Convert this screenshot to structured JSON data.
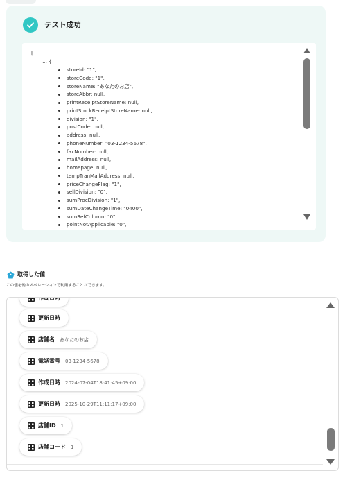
{
  "test": {
    "title": "テスト成功",
    "json_open": "[",
    "item_head": "1. {",
    "fields": [
      "storeId: \"1\",",
      "storeCode: \"1\",",
      "storeName: \"あなたのお店\",",
      "storeAbbr: null,",
      "printReceiptStoreName: null,",
      "printStockReceiptStoreName: null,",
      "division: \"1\",",
      "postCode: null,",
      "address: null,",
      "phoneNumber: \"03-1234-5678\",",
      "faxNumber: null,",
      "mailAddress: null,",
      "homepage: null,",
      "tempTranMailAddress: null,",
      "priceChangeFlag: \"1\",",
      "sellDivision: \"0\",",
      "sumProcDivision: \"1\",",
      "sumDateChangeTime: \"0400\",",
      "sumRefColumn: \"0\",",
      "pointNotApplicable: \"0\","
    ]
  },
  "acquired": {
    "title": "取得した値",
    "description": "この値を他のオペレーションで利用することができます。",
    "items": [
      {
        "label": "作成日時",
        "value": ""
      },
      {
        "label": "更新日時",
        "value": ""
      },
      {
        "label": "店舗名",
        "value": "あなたのお店"
      },
      {
        "label": "電話番号",
        "value": "03-1234-5678"
      },
      {
        "label": "作成日時",
        "value": "2024-07-04T18:41:45+09:00"
      },
      {
        "label": "更新日時",
        "value": "2025-10-29T11:11:17+09:00"
      },
      {
        "label": "店舗ID",
        "value": "1"
      },
      {
        "label": "店舗コード",
        "value": "1"
      }
    ]
  },
  "colors": {
    "accent": "#31c7c4",
    "panel_bg": "#eef8f6",
    "scroll_thumb": "#7b7b7b"
  },
  "icons": {
    "success": "check-icon",
    "acquired": "diamond-icon",
    "chip": "grid-icon"
  }
}
